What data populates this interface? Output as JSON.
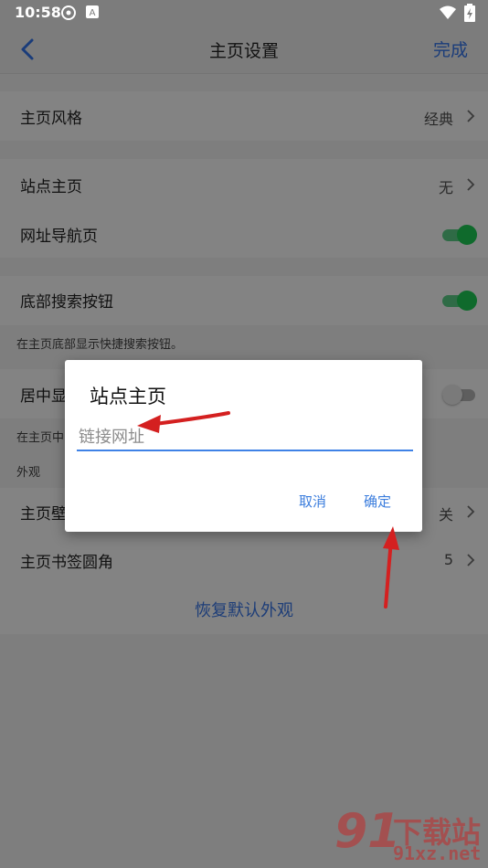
{
  "status_bar": {
    "time": "10:58"
  },
  "header": {
    "title": "主页设置",
    "done_label": "完成"
  },
  "settings": {
    "home_style": {
      "label": "主页风格",
      "value": "经典"
    },
    "site_home": {
      "label": "站点主页",
      "value": "无"
    },
    "url_nav": {
      "label": "网址导航页",
      "state": "on"
    },
    "bottom_search": {
      "label": "底部搜索按钮",
      "state": "on",
      "hint": "在主页底部显示快捷搜索按钮。"
    },
    "center_display": {
      "label": "居中显",
      "hint": "在主页中",
      "state": "off"
    },
    "appearance_header": "外观",
    "wallpaper": {
      "label": "主页壁",
      "value": "关"
    },
    "bookmark_radius": {
      "label": "主页书签圆角",
      "value": "5"
    },
    "restore_label": "恢复默认外观"
  },
  "dialog": {
    "title": "站点主页",
    "input_placeholder": "链接网址",
    "input_value": "",
    "cancel_label": "取消",
    "confirm_label": "确定"
  },
  "watermark": {
    "mark": "91",
    "text_cn": "下载站",
    "text_url": "91xz.net"
  },
  "colors": {
    "accent": "#3f82e6",
    "toggle_on": "#0f6a2c",
    "annotation_arrow": "#d42020",
    "dimmed_bg": "#7e7e7e"
  },
  "icons": [
    "back-chevron-icon",
    "chevron-right-icon",
    "wifi-icon",
    "battery-icon",
    "notification-icon"
  ]
}
